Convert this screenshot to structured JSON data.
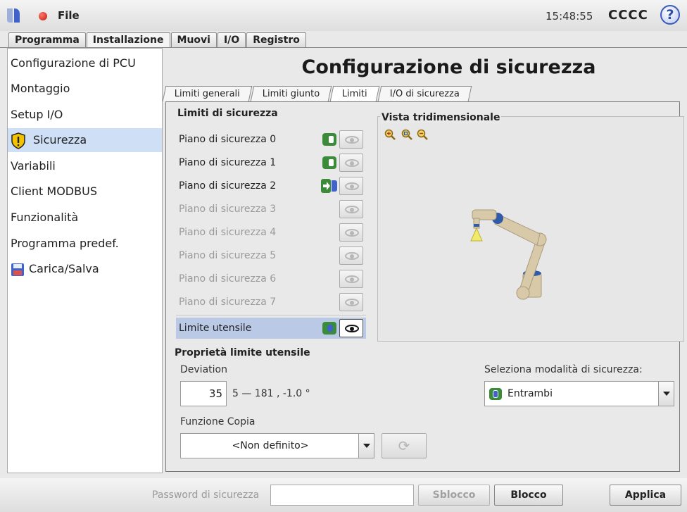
{
  "topbar": {
    "file_label": "File",
    "clock": "15:48:55",
    "robot_name": "CCCC",
    "help_label": "?"
  },
  "main_tabs": [
    {
      "label": "Programma",
      "active": false
    },
    {
      "label": "Installazione",
      "active": true
    },
    {
      "label": "Muovi",
      "active": false
    },
    {
      "label": "I/O",
      "active": false
    },
    {
      "label": "Registro",
      "active": false
    }
  ],
  "sidebar": {
    "items": [
      {
        "label": "Configurazione di PCU",
        "icon": null,
        "active": false
      },
      {
        "label": "Montaggio",
        "icon": null,
        "active": false
      },
      {
        "label": "Setup I/O",
        "icon": null,
        "active": false
      },
      {
        "label": "Sicurezza",
        "icon": "shield-warning-icon",
        "active": true
      },
      {
        "label": "Variabili",
        "icon": null,
        "active": false
      },
      {
        "label": "Client MODBUS",
        "icon": null,
        "active": false
      },
      {
        "label": "Funzionalità",
        "icon": null,
        "active": false
      },
      {
        "label": "Programma predef.",
        "icon": null,
        "active": false
      },
      {
        "label": "Carica/Salva",
        "icon": "floppy-disk-icon",
        "active": false
      }
    ]
  },
  "content": {
    "title": "Configurazione di sicurezza",
    "sub_tabs": [
      {
        "label": "Limiti generali",
        "active": false
      },
      {
        "label": "Limiti giunto",
        "active": false
      },
      {
        "label": "Limiti",
        "active": true
      },
      {
        "label": "I/O di sicurezza",
        "active": false
      }
    ],
    "limits_section_title": "Limiti di sicurezza",
    "planes": [
      {
        "label": "Piano di sicurezza 0",
        "enabled": true,
        "mode": "green",
        "visible": false
      },
      {
        "label": "Piano di sicurezza 1",
        "enabled": true,
        "mode": "green",
        "visible": false
      },
      {
        "label": "Piano di sicurezza 2",
        "enabled": true,
        "mode": "trigger",
        "visible": false
      },
      {
        "label": "Piano di sicurezza 3",
        "enabled": false,
        "mode": "none",
        "visible": false
      },
      {
        "label": "Piano di sicurezza 4",
        "enabled": false,
        "mode": "none",
        "visible": false
      },
      {
        "label": "Piano di sicurezza 5",
        "enabled": false,
        "mode": "none",
        "visible": false
      },
      {
        "label": "Piano di sicurezza 6",
        "enabled": false,
        "mode": "none",
        "visible": false
      },
      {
        "label": "Piano di sicurezza 7",
        "enabled": false,
        "mode": "none",
        "visible": false
      }
    ],
    "tool_limit": {
      "label": "Limite utensile",
      "mode": "blue",
      "visible": true,
      "selected": true
    },
    "view3d_title": "Vista tridimensionale",
    "tool_props_title": "Proprietà limite utensile",
    "deviation_label": "Deviation",
    "deviation_value": "35",
    "deviation_range": "5 — 181 , -1.0 °",
    "copy_label": "Funzione Copia",
    "copy_value": "<Non definito>",
    "mode_label": "Seleziona modalità di sicurezza:",
    "mode_value": "Entrambi"
  },
  "bottombar": {
    "password_label": "Password di sicurezza",
    "password_value": "",
    "unlock_label": "Sblocco",
    "lock_label": "Blocco",
    "apply_label": "Applica"
  },
  "colors": {
    "accent_blue": "#3f63c8",
    "toggle_green": "#3a8c3a",
    "selection": "#b9c9e6",
    "sidebar_active": "#cfdff5",
    "robot_arm": "#d8c9a8",
    "robot_joint": "#2f5ba8"
  }
}
